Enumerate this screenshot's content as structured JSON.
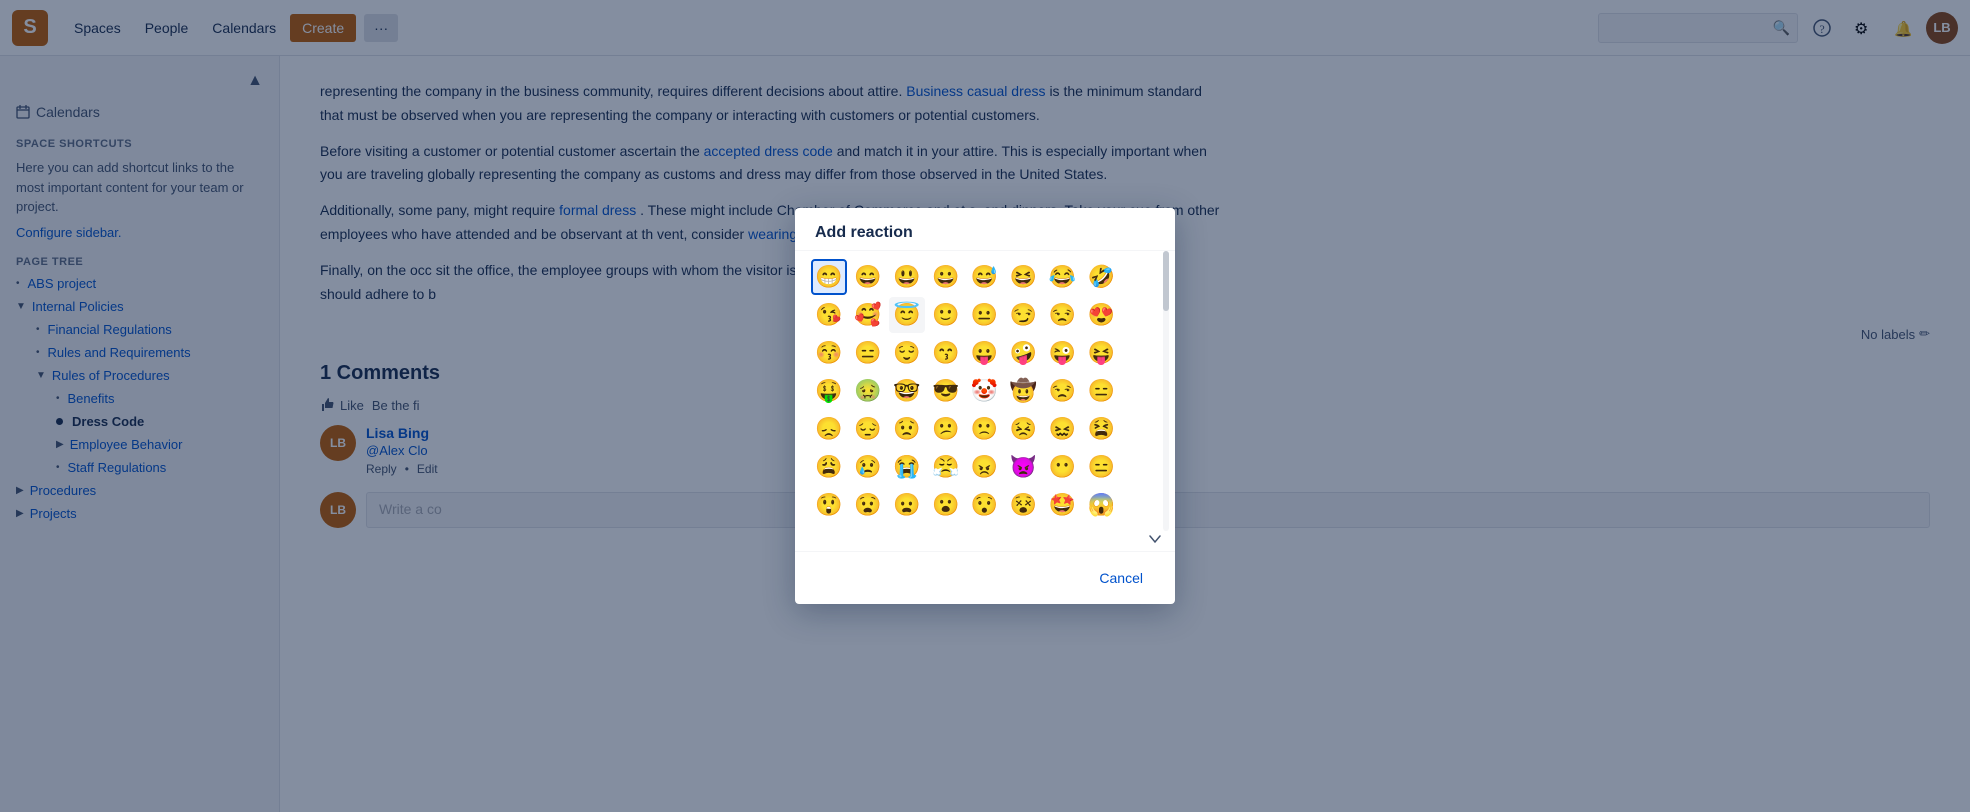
{
  "navbar": {
    "logo": "S",
    "spaces_label": "Spaces",
    "people_label": "People",
    "calendars_label": "Calendars",
    "create_label": "Create",
    "more_label": "···",
    "search_placeholder": ""
  },
  "sidebar": {
    "calendars_label": "Calendars",
    "shortcuts_title": "SPACE SHORTCUTS",
    "shortcuts_text": "Here you can add shortcut links to the most important content for your team or project.",
    "configure_link": "Configure sidebar.",
    "page_tree_title": "PAGE TREE",
    "tree_items": [
      {
        "id": "abs",
        "label": "ABS project",
        "level": 0,
        "type": "link",
        "toggle": "bullet"
      },
      {
        "id": "internal-policies",
        "label": "Internal Policies",
        "level": 0,
        "type": "link",
        "toggle": "collapse"
      },
      {
        "id": "financial-regs",
        "label": "Financial Regulations",
        "level": 1,
        "type": "link",
        "toggle": "bullet"
      },
      {
        "id": "rules-reqs",
        "label": "Rules and Requirements",
        "level": 1,
        "type": "link",
        "toggle": "bullet"
      },
      {
        "id": "rules-procs",
        "label": "Rules of Procedures",
        "level": 1,
        "type": "link",
        "toggle": "collapse"
      },
      {
        "id": "benefits",
        "label": "Benefits",
        "level": 2,
        "type": "link",
        "toggle": "bullet"
      },
      {
        "id": "dress-code",
        "label": "Dress Code",
        "level": 2,
        "type": "active",
        "toggle": "dot"
      },
      {
        "id": "employee-behavior",
        "label": "Employee Behavior",
        "level": 2,
        "type": "link",
        "toggle": "collapse"
      },
      {
        "id": "staff-regulations",
        "label": "Staff Regulations",
        "level": 2,
        "type": "link",
        "toggle": "bullet"
      },
      {
        "id": "procedures",
        "label": "Procedures",
        "level": 0,
        "type": "link",
        "toggle": "expand"
      },
      {
        "id": "projects",
        "label": "Projects",
        "level": 0,
        "type": "link",
        "toggle": "expand"
      }
    ]
  },
  "content": {
    "para1": "representing the company in the business community, requires different decisions about attire.",
    "link1": "Business casual dress",
    "para1b": "is the minimum standard that must be observed when you are representing the company or interacting with customers or potential customers.",
    "para2a": "Before visiting a customer or potential customer ascertain the",
    "link2": "accepted dress code",
    "para2b": "and match it in your attire. This is especially important when you are traveling globally representing the company as customs and dress may differ from those observed in the United States.",
    "para3a": "Additionally, some",
    "para3b": "pany, might require",
    "link3": "formal dress",
    "para3c": ". These might include Chamber of Commerce and ot",
    "para3d": "s, and dinners. Take your cue from other employees who have attended and be observant at th",
    "para3e": "vent, consider",
    "link4": "wearing formal dress",
    "para3f": ".",
    "para4a": "Finally, on the occ",
    "para4b": "sit the office, the employee groups with whom the visitor is interacting,",
    "para4c": "should adhere to b",
    "labels_text": "No labels",
    "comments_title": "1 Comments",
    "like_label": "Like",
    "be_first_text": "Be the fi",
    "comment_author": "Lisa Bing",
    "comment_mention": "@Alex Clo",
    "reply_label": "Reply",
    "edit_label": "Edit",
    "write_placeholder": "Write a co"
  },
  "modal": {
    "title": "Add reaction",
    "cancel_label": "Cancel",
    "emojis_row1": [
      "😁",
      "😄",
      "😃",
      "😀",
      "😅",
      "😆",
      "😂",
      "🤣"
    ],
    "emojis_row2": [
      "😘",
      "🥰",
      "😇",
      "🙂",
      "😐",
      "😏",
      "😒",
      "😍"
    ],
    "emojis_row3": [
      "😚",
      "😑",
      "😌",
      "😙",
      "😛",
      "🤪",
      "😜",
      "😝"
    ],
    "emojis_row4": [
      "🤑",
      "🤢",
      "🤓",
      "😎",
      "🤡",
      "🤠",
      "😒",
      "😑"
    ],
    "emojis_row5": [
      "😞",
      "😔",
      "😟",
      "😕",
      "🙁",
      "😣",
      "😖",
      "😫"
    ],
    "emojis_row6": [
      "😩",
      "😢",
      "😭",
      "😤",
      "😠",
      "👿",
      "😶",
      "😑"
    ],
    "emojis_row7": [
      "😲",
      "😧",
      "😦",
      "😮",
      "😯",
      "😵",
      "🤩",
      "😱"
    ],
    "selected_emoji_index": 0
  }
}
